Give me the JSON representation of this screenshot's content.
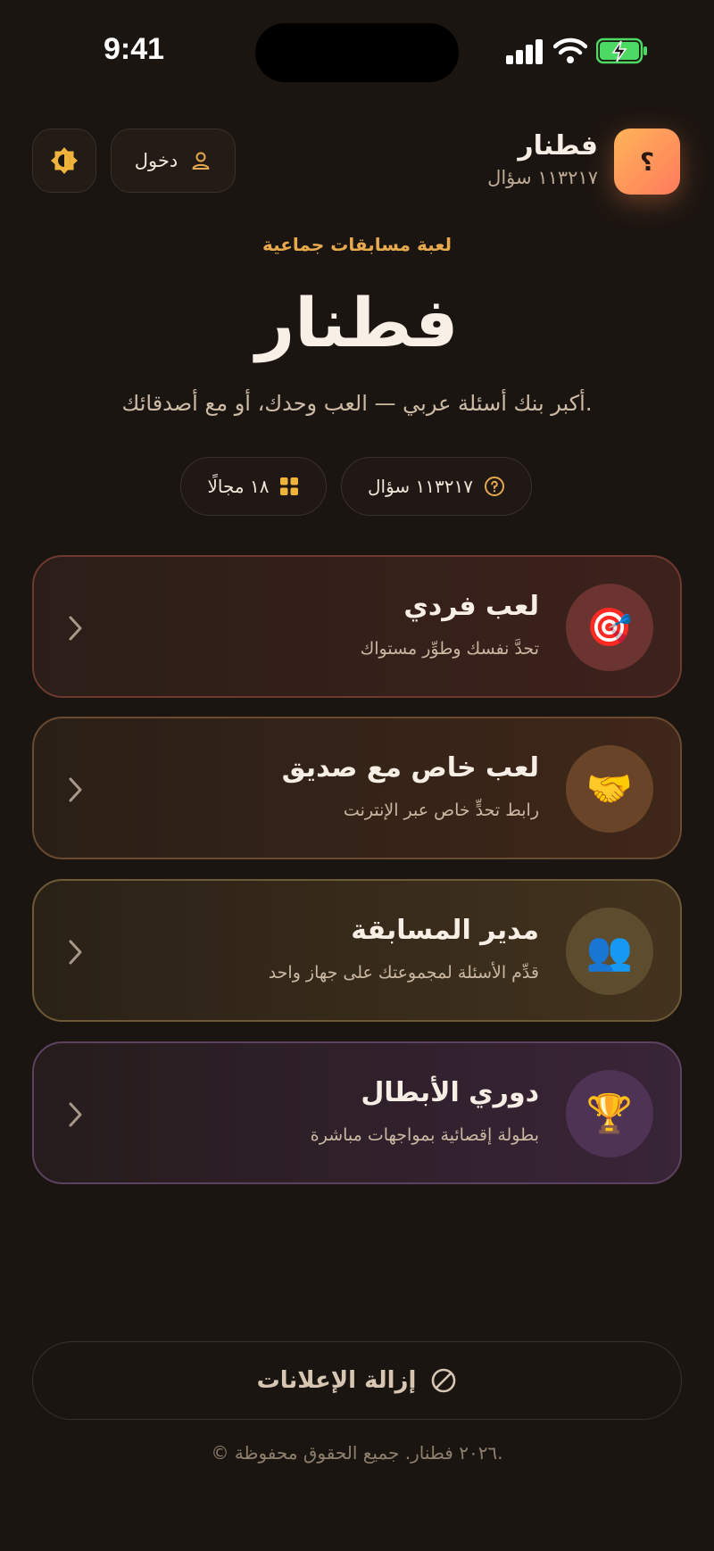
{
  "status_bar": {
    "time": "9:41"
  },
  "header": {
    "brand_name": "فطنار",
    "question_count": "١١٣٢١٧ سؤال",
    "logo_glyph": "؟",
    "login_label": "دخول",
    "icons": {
      "login": "user-icon",
      "theme": "contrast-icon"
    }
  },
  "hero": {
    "kicker": "لعبة مسابقات جماعية",
    "title": "فطنار",
    "subtitle": "أكبر بنك أسئلة عربي — العب وحدك، أو مع أصدقائك.",
    "chips": [
      {
        "label": "١١٣٢١٧ سؤال",
        "icon": "question-circle-icon"
      },
      {
        "label": "١٨ مجالًا",
        "icon": "grid-icon"
      }
    ]
  },
  "modes": [
    {
      "title": "لعب فردي",
      "description": "تحدَّ نفسك وطوِّر مستواك",
      "icon": "🎯",
      "icon_name": "target-icon"
    },
    {
      "title": "لعب خاص مع صديق",
      "description": "رابط تحدٍّ خاص عبر الإنترنت",
      "icon": "🤝",
      "icon_name": "handshake-icon"
    },
    {
      "title": "مدير المسابقة",
      "description": "قدِّم الأسئلة لمجموعتك على جهاز واحد",
      "icon": "👥",
      "icon_name": "group-icon"
    },
    {
      "title": "دوري الأبطال",
      "description": "بطولة إقصائية بمواجهات مباشرة",
      "icon": "🏆",
      "icon_name": "trophy-icon"
    }
  ],
  "remove_ads": {
    "label": "إزالة الإعلانات",
    "icon": "block-icon"
  },
  "footer": {
    "copyright": "© ٢٠٢٦ فطنار. جميع الحقوق محفوظة."
  },
  "colors": {
    "background": "#1b1511",
    "accent": "#e7a94d",
    "logo_gradient": [
      "#ffb45a",
      "#ff7a5c"
    ]
  }
}
